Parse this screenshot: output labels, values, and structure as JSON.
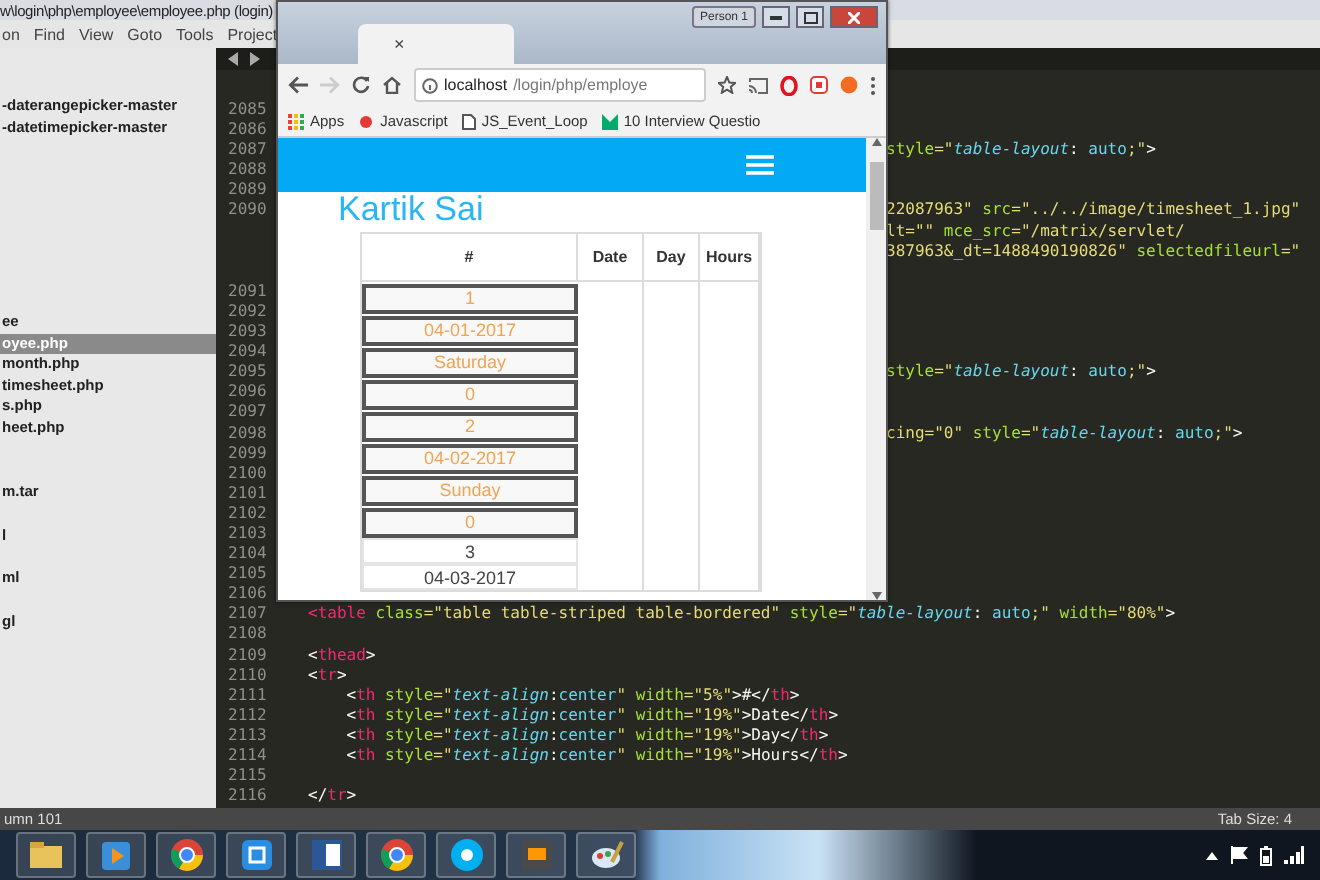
{
  "editor": {
    "title": "w\\login\\php\\employee\\employee.php (login)",
    "menu": [
      "on",
      "Find",
      "View",
      "Goto",
      "Tools",
      "Project"
    ],
    "sidebar": {
      "groups": [
        {
          "items": [
            {
              "label": "-daterangepicker-master",
              "selected": false
            },
            {
              "label": "-datetimepicker-master",
              "selected": false
            }
          ]
        },
        {
          "items": [
            {
              "label": "ee",
              "selected": false
            },
            {
              "label": "oyee.php",
              "selected": true
            },
            {
              "label": "month.php",
              "selected": false
            },
            {
              "label": "timesheet.php",
              "selected": false
            },
            {
              "label": "s.php",
              "selected": false
            },
            {
              "label": "heet.php",
              "selected": false
            }
          ]
        },
        {
          "items": [
            {
              "label": "m.tar",
              "selected": false
            }
          ]
        },
        {
          "items": [
            {
              "label": "l",
              "selected": false
            }
          ]
        },
        {
          "items": [
            {
              "label": "ml",
              "selected": false
            }
          ]
        },
        {
          "items": [
            {
              "label": "gl",
              "selected": false
            }
          ]
        }
      ]
    },
    "lines": [
      {
        "number": "2085"
      },
      {
        "number": "2086"
      },
      {
        "number": "2087",
        "kind": "clipped",
        "rows": [
          [
            {
              "kind": "attr",
              "text": "style"
            },
            {
              "kind": "str",
              "text": "=\""
            },
            {
              "kind": "ital",
              "text": "table-layout"
            },
            {
              "kind": "plain",
              "text": ": "
            },
            {
              "kind": "val",
              "text": "auto"
            },
            {
              "kind": "str",
              "text": ";\""
            },
            {
              "kind": "plain",
              "text": ">"
            }
          ]
        ]
      },
      {
        "number": "2088"
      },
      {
        "number": "2089"
      },
      {
        "number": "2090",
        "kind": "clipped",
        "rows": [
          [
            {
              "kind": "str",
              "text": "22087963\""
            },
            {
              "kind": "attr",
              "text": " src"
            },
            {
              "kind": "str",
              "text": "=\"../../image/timesheet_1.jpg\""
            }
          ],
          [
            {
              "kind": "str",
              "text": "lt=\"\""
            },
            {
              "kind": "attr",
              "text": " mce_src"
            },
            {
              "kind": "str",
              "text": "=\"/matrix/servlet/"
            }
          ],
          [
            {
              "kind": "str",
              "text": "387963&_dt=1488490190826\""
            },
            {
              "kind": "attr",
              "text": " selectedfileurl"
            },
            {
              "kind": "str",
              "text": "=\""
            }
          ],
          []
        ]
      },
      {
        "number": "2091"
      },
      {
        "number": "2092"
      },
      {
        "number": "2093"
      },
      {
        "number": "2094"
      },
      {
        "number": "2095",
        "kind": "clipped",
        "rows": [
          [
            {
              "kind": "attr",
              "text": "style"
            },
            {
              "kind": "str",
              "text": "=\""
            },
            {
              "kind": "ital",
              "text": "table-layout"
            },
            {
              "kind": "plain",
              "text": ": "
            },
            {
              "kind": "val",
              "text": "auto"
            },
            {
              "kind": "str",
              "text": ";\""
            },
            {
              "kind": "plain",
              "text": ">"
            }
          ]
        ]
      },
      {
        "number": "2096"
      },
      {
        "number": "2097"
      },
      {
        "number": "2098",
        "kind": "clipped",
        "rows": [
          [
            {
              "kind": "str",
              "text": "cing=\"0\""
            },
            {
              "kind": "attr",
              "text": " style"
            },
            {
              "kind": "str",
              "text": "=\""
            },
            {
              "kind": "ital",
              "text": "table-layout"
            },
            {
              "kind": "plain",
              "text": ": "
            },
            {
              "kind": "val",
              "text": "auto"
            },
            {
              "kind": "str",
              "text": ";\""
            },
            {
              "kind": "plain",
              "text": ">"
            }
          ]
        ]
      },
      {
        "number": "2099"
      },
      {
        "number": "2100"
      },
      {
        "number": "2101"
      },
      {
        "number": "2102"
      },
      {
        "number": "2103"
      },
      {
        "number": "2104"
      },
      {
        "number": "2105"
      },
      {
        "number": "2106"
      },
      {
        "number": "2107",
        "kind": "full",
        "rows": [
          [
            {
              "kind": "tag",
              "text": "<table"
            },
            {
              "kind": "attr",
              "text": " class"
            },
            {
              "kind": "str",
              "text": "=\"table table-striped table-bordered\""
            },
            {
              "kind": "attr",
              "text": " style"
            },
            {
              "kind": "str",
              "text": "=\""
            },
            {
              "kind": "ital",
              "text": "table-layout"
            },
            {
              "kind": "plain",
              "text": ": "
            },
            {
              "kind": "val",
              "text": "auto"
            },
            {
              "kind": "str",
              "text": ";\""
            },
            {
              "kind": "attr",
              "text": " width"
            },
            {
              "kind": "str",
              "text": "=\"80%\""
            },
            {
              "kind": "plain",
              "text": ">"
            }
          ]
        ]
      },
      {
        "number": "2108"
      },
      {
        "number": "2109",
        "kind": "full",
        "rows": [
          [
            {
              "kind": "plain",
              "text": "<"
            },
            {
              "kind": "tag",
              "text": "thead"
            },
            {
              "kind": "plain",
              "text": ">"
            }
          ]
        ]
      },
      {
        "number": "2110",
        "kind": "full",
        "rows": [
          [
            {
              "kind": "plain",
              "text": "<"
            },
            {
              "kind": "tag",
              "text": "tr"
            },
            {
              "kind": "plain",
              "text": ">"
            }
          ]
        ]
      },
      {
        "number": "2111",
        "kind": "full",
        "rows": [
          [
            {
              "kind": "plain",
              "text": "    <"
            },
            {
              "kind": "tag",
              "text": "th"
            },
            {
              "kind": "attr",
              "text": " style"
            },
            {
              "kind": "str",
              "text": "=\""
            },
            {
              "kind": "ital",
              "text": "text-align"
            },
            {
              "kind": "plain",
              "text": ":"
            },
            {
              "kind": "val",
              "text": "center"
            },
            {
              "kind": "str",
              "text": "\""
            },
            {
              "kind": "attr",
              "text": " width"
            },
            {
              "kind": "str",
              "text": "=\"5%\""
            },
            {
              "kind": "plain",
              "text": ">#</"
            },
            {
              "kind": "tag",
              "text": "th"
            },
            {
              "kind": "plain",
              "text": ">"
            }
          ]
        ]
      },
      {
        "number": "2112",
        "kind": "full",
        "rows": [
          [
            {
              "kind": "plain",
              "text": "    <"
            },
            {
              "kind": "tag",
              "text": "th"
            },
            {
              "kind": "attr",
              "text": " style"
            },
            {
              "kind": "str",
              "text": "=\""
            },
            {
              "kind": "ital",
              "text": "text-align"
            },
            {
              "kind": "plain",
              "text": ":"
            },
            {
              "kind": "val",
              "text": "center"
            },
            {
              "kind": "str",
              "text": "\""
            },
            {
              "kind": "attr",
              "text": " width"
            },
            {
              "kind": "str",
              "text": "=\"19%\""
            },
            {
              "kind": "plain",
              "text": ">Date</"
            },
            {
              "kind": "tag",
              "text": "th"
            },
            {
              "kind": "plain",
              "text": ">"
            }
          ]
        ]
      },
      {
        "number": "2113",
        "kind": "full",
        "rows": [
          [
            {
              "kind": "plain",
              "text": "    <"
            },
            {
              "kind": "tag",
              "text": "th"
            },
            {
              "kind": "attr",
              "text": " style"
            },
            {
              "kind": "str",
              "text": "=\""
            },
            {
              "kind": "ital",
              "text": "text-align"
            },
            {
              "kind": "plain",
              "text": ":"
            },
            {
              "kind": "val",
              "text": "center"
            },
            {
              "kind": "str",
              "text": "\""
            },
            {
              "kind": "attr",
              "text": " width"
            },
            {
              "kind": "str",
              "text": "=\"19%\""
            },
            {
              "kind": "plain",
              "text": ">Day</"
            },
            {
              "kind": "tag",
              "text": "th"
            },
            {
              "kind": "plain",
              "text": ">"
            }
          ]
        ]
      },
      {
        "number": "2114",
        "kind": "full",
        "rows": [
          [
            {
              "kind": "plain",
              "text": "    <"
            },
            {
              "kind": "tag",
              "text": "th"
            },
            {
              "kind": "attr",
              "text": " style"
            },
            {
              "kind": "str",
              "text": "=\""
            },
            {
              "kind": "ital",
              "text": "text-align"
            },
            {
              "kind": "plain",
              "text": ":"
            },
            {
              "kind": "val",
              "text": "center"
            },
            {
              "kind": "str",
              "text": "\""
            },
            {
              "kind": "attr",
              "text": " width"
            },
            {
              "kind": "str",
              "text": "=\"19%\""
            },
            {
              "kind": "plain",
              "text": ">Hours</"
            },
            {
              "kind": "tag",
              "text": "th"
            },
            {
              "kind": "plain",
              "text": ">"
            }
          ]
        ]
      },
      {
        "number": "2115"
      },
      {
        "number": "2116",
        "kind": "full",
        "rows": [
          [
            {
              "kind": "plain",
              "text": "</"
            },
            {
              "kind": "tag",
              "text": "tr"
            },
            {
              "kind": "plain",
              "text": ">"
            }
          ]
        ]
      }
    ],
    "status_bar": {
      "left": "umn 101",
      "right": "Tab Size: 4"
    }
  },
  "browser": {
    "tab_close": "×",
    "profile": "Person 1",
    "address_host": "localhost",
    "address_path": "/login/php/employe",
    "bookmarks": [
      {
        "kind": "apps",
        "label": "Apps"
      },
      {
        "kind": "bug",
        "label": "Javascript"
      },
      {
        "kind": "page",
        "label": "JS_Event_Loop"
      },
      {
        "kind": "m",
        "label": "10 Interview Questio"
      }
    ],
    "page": {
      "heading": "Kartik Sai",
      "columns": [
        "#",
        "Date",
        "Day",
        "Hours"
      ],
      "rows": [
        {
          "value": "1",
          "highlighted": true
        },
        {
          "value": "04-01-2017",
          "highlighted": true
        },
        {
          "value": "Saturday",
          "highlighted": true
        },
        {
          "value": "0",
          "highlighted": true
        },
        {
          "value": "2",
          "highlighted": true
        },
        {
          "value": "04-02-2017",
          "highlighted": true
        },
        {
          "value": "Sunday",
          "highlighted": true
        },
        {
          "value": "0",
          "highlighted": true
        },
        {
          "value": "3",
          "highlighted": false
        },
        {
          "value": "04-03-2017",
          "highlighted": false
        }
      ]
    }
  },
  "taskbar": {
    "apps": [
      {
        "kind": "folder"
      },
      {
        "kind": "player"
      },
      {
        "kind": "browser"
      },
      {
        "kind": "capture"
      },
      {
        "kind": "word"
      },
      {
        "kind": "browser"
      },
      {
        "kind": "chat"
      },
      {
        "kind": "editor"
      },
      {
        "kind": "paint"
      }
    ]
  }
}
